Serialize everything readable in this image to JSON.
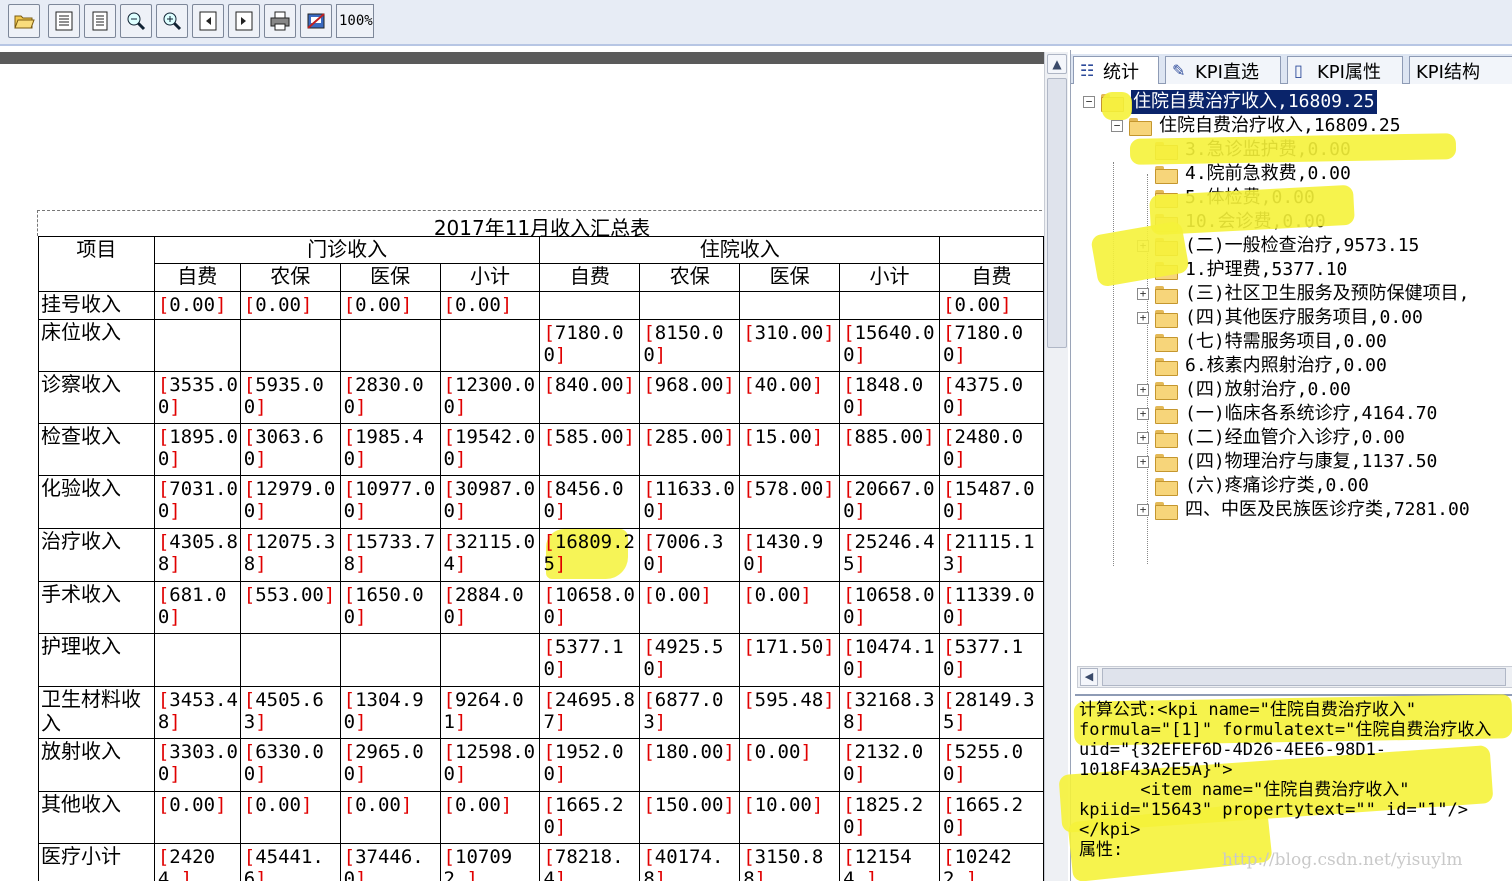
{
  "toolbar": {
    "zoom_label": "100%",
    "buttons": [
      "open-folder-icon",
      "list-icon",
      "document-icon",
      "zoom-out-icon",
      "zoom-in-icon",
      "prev-page-icon",
      "next-page-icon",
      "print-icon",
      "export-icon"
    ]
  },
  "report": {
    "title": "2017年11月收入汇总表",
    "col_item": "项目",
    "group_outpatient": "门诊收入",
    "group_inpatient": "住院收入",
    "sub_headers": [
      "自费",
      "农保",
      "医保",
      "小计",
      "自费",
      "农保",
      "医保",
      "小计",
      "自费"
    ],
    "rows": [
      {
        "label": "挂号收入",
        "cells": [
          "0.00",
          "0.00",
          "0.00",
          "0.00",
          "",
          "",
          "",
          "",
          "0.00"
        ]
      },
      {
        "label": "床位收入",
        "cells": [
          "",
          "",
          "",
          "",
          "7180.00",
          "8150.00",
          "310.00",
          "15640.00",
          "7180.00"
        ]
      },
      {
        "label": "诊察收入",
        "cells": [
          "3535.00",
          "5935.00",
          "2830.00",
          "12300.00",
          "840.00",
          "968.00",
          "40.00",
          "1848.00",
          "4375.00"
        ]
      },
      {
        "label": "检查收入",
        "cells": [
          "1895.00",
          "3063.60",
          "1985.40",
          "19542.00",
          "585.00",
          "285.00",
          "15.00",
          "885.00",
          "2480.00"
        ]
      },
      {
        "label": "化验收入",
        "cells": [
          "7031.00",
          "12979.00",
          "10977.00",
          "30987.00",
          "8456.00",
          "11633.00",
          "578.00",
          "20667.00",
          "15487.00"
        ]
      },
      {
        "label": "治疗收入",
        "cells": [
          "4305.88",
          "12075.38",
          "15733.78",
          "32115.04",
          "16809.25",
          "7006.30",
          "1430.90",
          "25246.45",
          "21115.13"
        ]
      },
      {
        "label": "手术收入",
        "cells": [
          "681.00",
          "553.00",
          "1650.00",
          "2884.00",
          "10658.00",
          "0.00",
          "0.00",
          "10658.00",
          "11339.00"
        ]
      },
      {
        "label": "护理收入",
        "cells": [
          "",
          "",
          "",
          "",
          "5377.10",
          "4925.50",
          "171.50",
          "10474.10",
          "5377.10"
        ]
      },
      {
        "label": "卫生材料收入",
        "cells": [
          "3453.48",
          "4505.63",
          "1304.90",
          "9264.01",
          "24695.87",
          "6877.03",
          "595.48",
          "32168.38",
          "28149.35"
        ]
      },
      {
        "label": "放射收入",
        "cells": [
          "3303.00",
          "6330.00",
          "2965.00",
          "12598.00",
          "1952.00",
          "180.00",
          "0.00",
          "2132.00",
          "5255.00"
        ]
      },
      {
        "label": "其他收入",
        "cells": [
          "0.00",
          "0.00",
          "0.00",
          "0.00",
          "1665.20",
          "150.00",
          "10.00",
          "1825.20",
          "1665.20"
        ]
      },
      {
        "label": "医疗小计",
        "cells": [
          "24204.",
          "45441.6",
          "37446.0",
          "107092.",
          "78218.4",
          "40174.8",
          "3150.88",
          "121544.",
          "102422."
        ]
      }
    ]
  },
  "panel": {
    "tabs": [
      "统计",
      "KPI直选",
      "KPI属性",
      "KPI结构"
    ],
    "tree": [
      {
        "label": "住院自费治疗收入,16809.25",
        "toggle": "−",
        "selected": true
      },
      {
        "label": "住院自费治疗收入,16809.25",
        "toggle": "−"
      },
      {
        "label": "3.急诊监护费,0.00",
        "toggle": ""
      },
      {
        "label": "4.院前急救费,0.00",
        "toggle": ""
      },
      {
        "label": "5.体检费,0.00",
        "toggle": ""
      },
      {
        "label": "10.会诊费,0.00",
        "toggle": ""
      },
      {
        "label": "(二)一般检查治疗,9573.15",
        "toggle": "+"
      },
      {
        "label": "1.护理费,5377.10",
        "toggle": ""
      },
      {
        "label": "(三)社区卫生服务及预防保健项目,",
        "toggle": "+"
      },
      {
        "label": "(四)其他医疗服务项目,0.00",
        "toggle": "+"
      },
      {
        "label": "(七)特需服务项目,0.00",
        "toggle": ""
      },
      {
        "label": "6.核素内照射治疗,0.00",
        "toggle": ""
      },
      {
        "label": "(四)放射治疗,0.00",
        "toggle": "+"
      },
      {
        "label": "(一)临床各系统诊疗,4164.70",
        "toggle": "+"
      },
      {
        "label": "(二)经血管介入诊疗,0.00",
        "toggle": "+"
      },
      {
        "label": "(四)物理治疗与康复,1137.50",
        "toggle": "+"
      },
      {
        "label": "(六)疼痛诊疗类,0.00",
        "toggle": ""
      },
      {
        "label": "四、中医及民族医诊疗类,7281.00",
        "toggle": "+"
      }
    ],
    "formula_lines": [
      "计算公式:<kpi name=\"住院自费治疗收入\"",
      "formula=\"[1]\" formulatext=\"住院自费治疗收入",
      "uid=\"{32EFEF6D-4D26-4EE6-98D1-",
      "1018F43A2E5A}\">",
      "      <item name=\"住院自费治疗收入\"",
      "kpiid=\"15643\" propertytext=\"\" id=\"1\"/>",
      "</kpi>",
      "属性:"
    ],
    "watermark": "http://blog.csdn.net/yisuylm"
  },
  "colors": {
    "bracket": "#e00000",
    "highlight": "#f5f23a",
    "selection": "#0a246a"
  }
}
